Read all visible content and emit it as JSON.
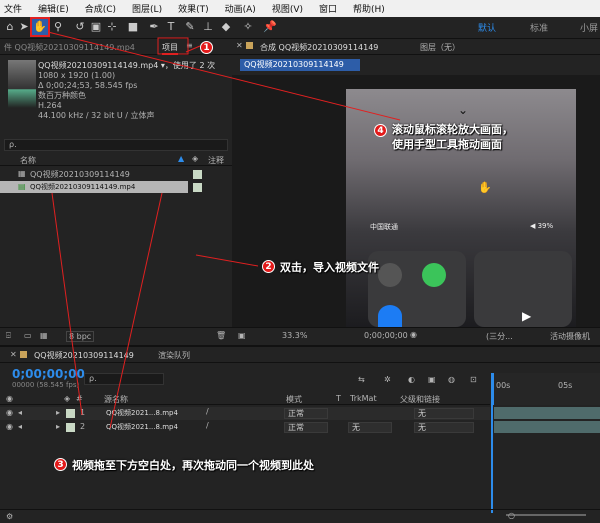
{
  "menu": [
    "文件",
    "编辑(E)",
    "合成(C)",
    "图层(L)",
    "效果(T)",
    "动画(A)",
    "视图(V)",
    "窗口",
    "帮助(H)"
  ],
  "workspace": {
    "active": "默认",
    "other": "标准",
    "small": "小屏"
  },
  "project": {
    "tab_prefix": "件 QQ视频20210309114149.mp4",
    "tab": "项目",
    "file_name": "QQ视频20210309114149.mp4 ▾，使用了 2 次",
    "meta": [
      "1080 x 1920 (1.00)",
      "Δ 0;00;24;53, 58.545 fps",
      "数百万种颜色",
      "H.264",
      "44.100 kHz / 32 bit U / 立体声"
    ],
    "search_placeholder": "ρ.",
    "col_name": "名称",
    "col_note": "注释",
    "items": [
      "QQ视频20210309114149",
      "QQ视频20210309114149.mp4"
    ],
    "bpc": "8 bpc"
  },
  "comp": {
    "tab": "合成 QQ视频20210309114149",
    "layer_tab": "图层（无）",
    "crumb": "QQ视频20210309114149",
    "carrier": "中国联通",
    "battery": "◀ 39%",
    "zoom": "33.3%",
    "time": "0;00;00;00",
    "view": "(三分...",
    "camera": "活动摄像机"
  },
  "timeline": {
    "tab": "QQ视频20210309114149",
    "render_tab": "渲染队列",
    "timecode": "0;00;00;00",
    "fps": "00000 (58.545 fps)",
    "headers": {
      "src": "源名称",
      "mode": "模式",
      "t": "T",
      "trkmat": "TrkMat",
      "parent": "父级和链接"
    },
    "ruler": [
      "00s",
      "05s"
    ],
    "layers": [
      {
        "num": "1",
        "name": "QQ视频2021...8.mp4",
        "mode": "正常",
        "trkmat": "",
        "parent": "无"
      },
      {
        "num": "2",
        "name": "QQ视频2021...8.mp4",
        "mode": "正常",
        "trkmat": "无",
        "parent": "无"
      }
    ]
  },
  "annotations": [
    {
      "num": "1"
    },
    {
      "num": "2",
      "text": "双击，导入视频文件"
    },
    {
      "num": "3",
      "text": "视频拖至下方空白处，再次拖动同一个视频到此处"
    },
    {
      "num": "4",
      "line1": "滚动鼠标滚轮放大画面，",
      "line2": "使用手型工具拖动画面"
    }
  ],
  "colors": {
    "accent": "#2d8ceb",
    "callout": "#e31a1a",
    "timecode": "#2d8ceb"
  }
}
